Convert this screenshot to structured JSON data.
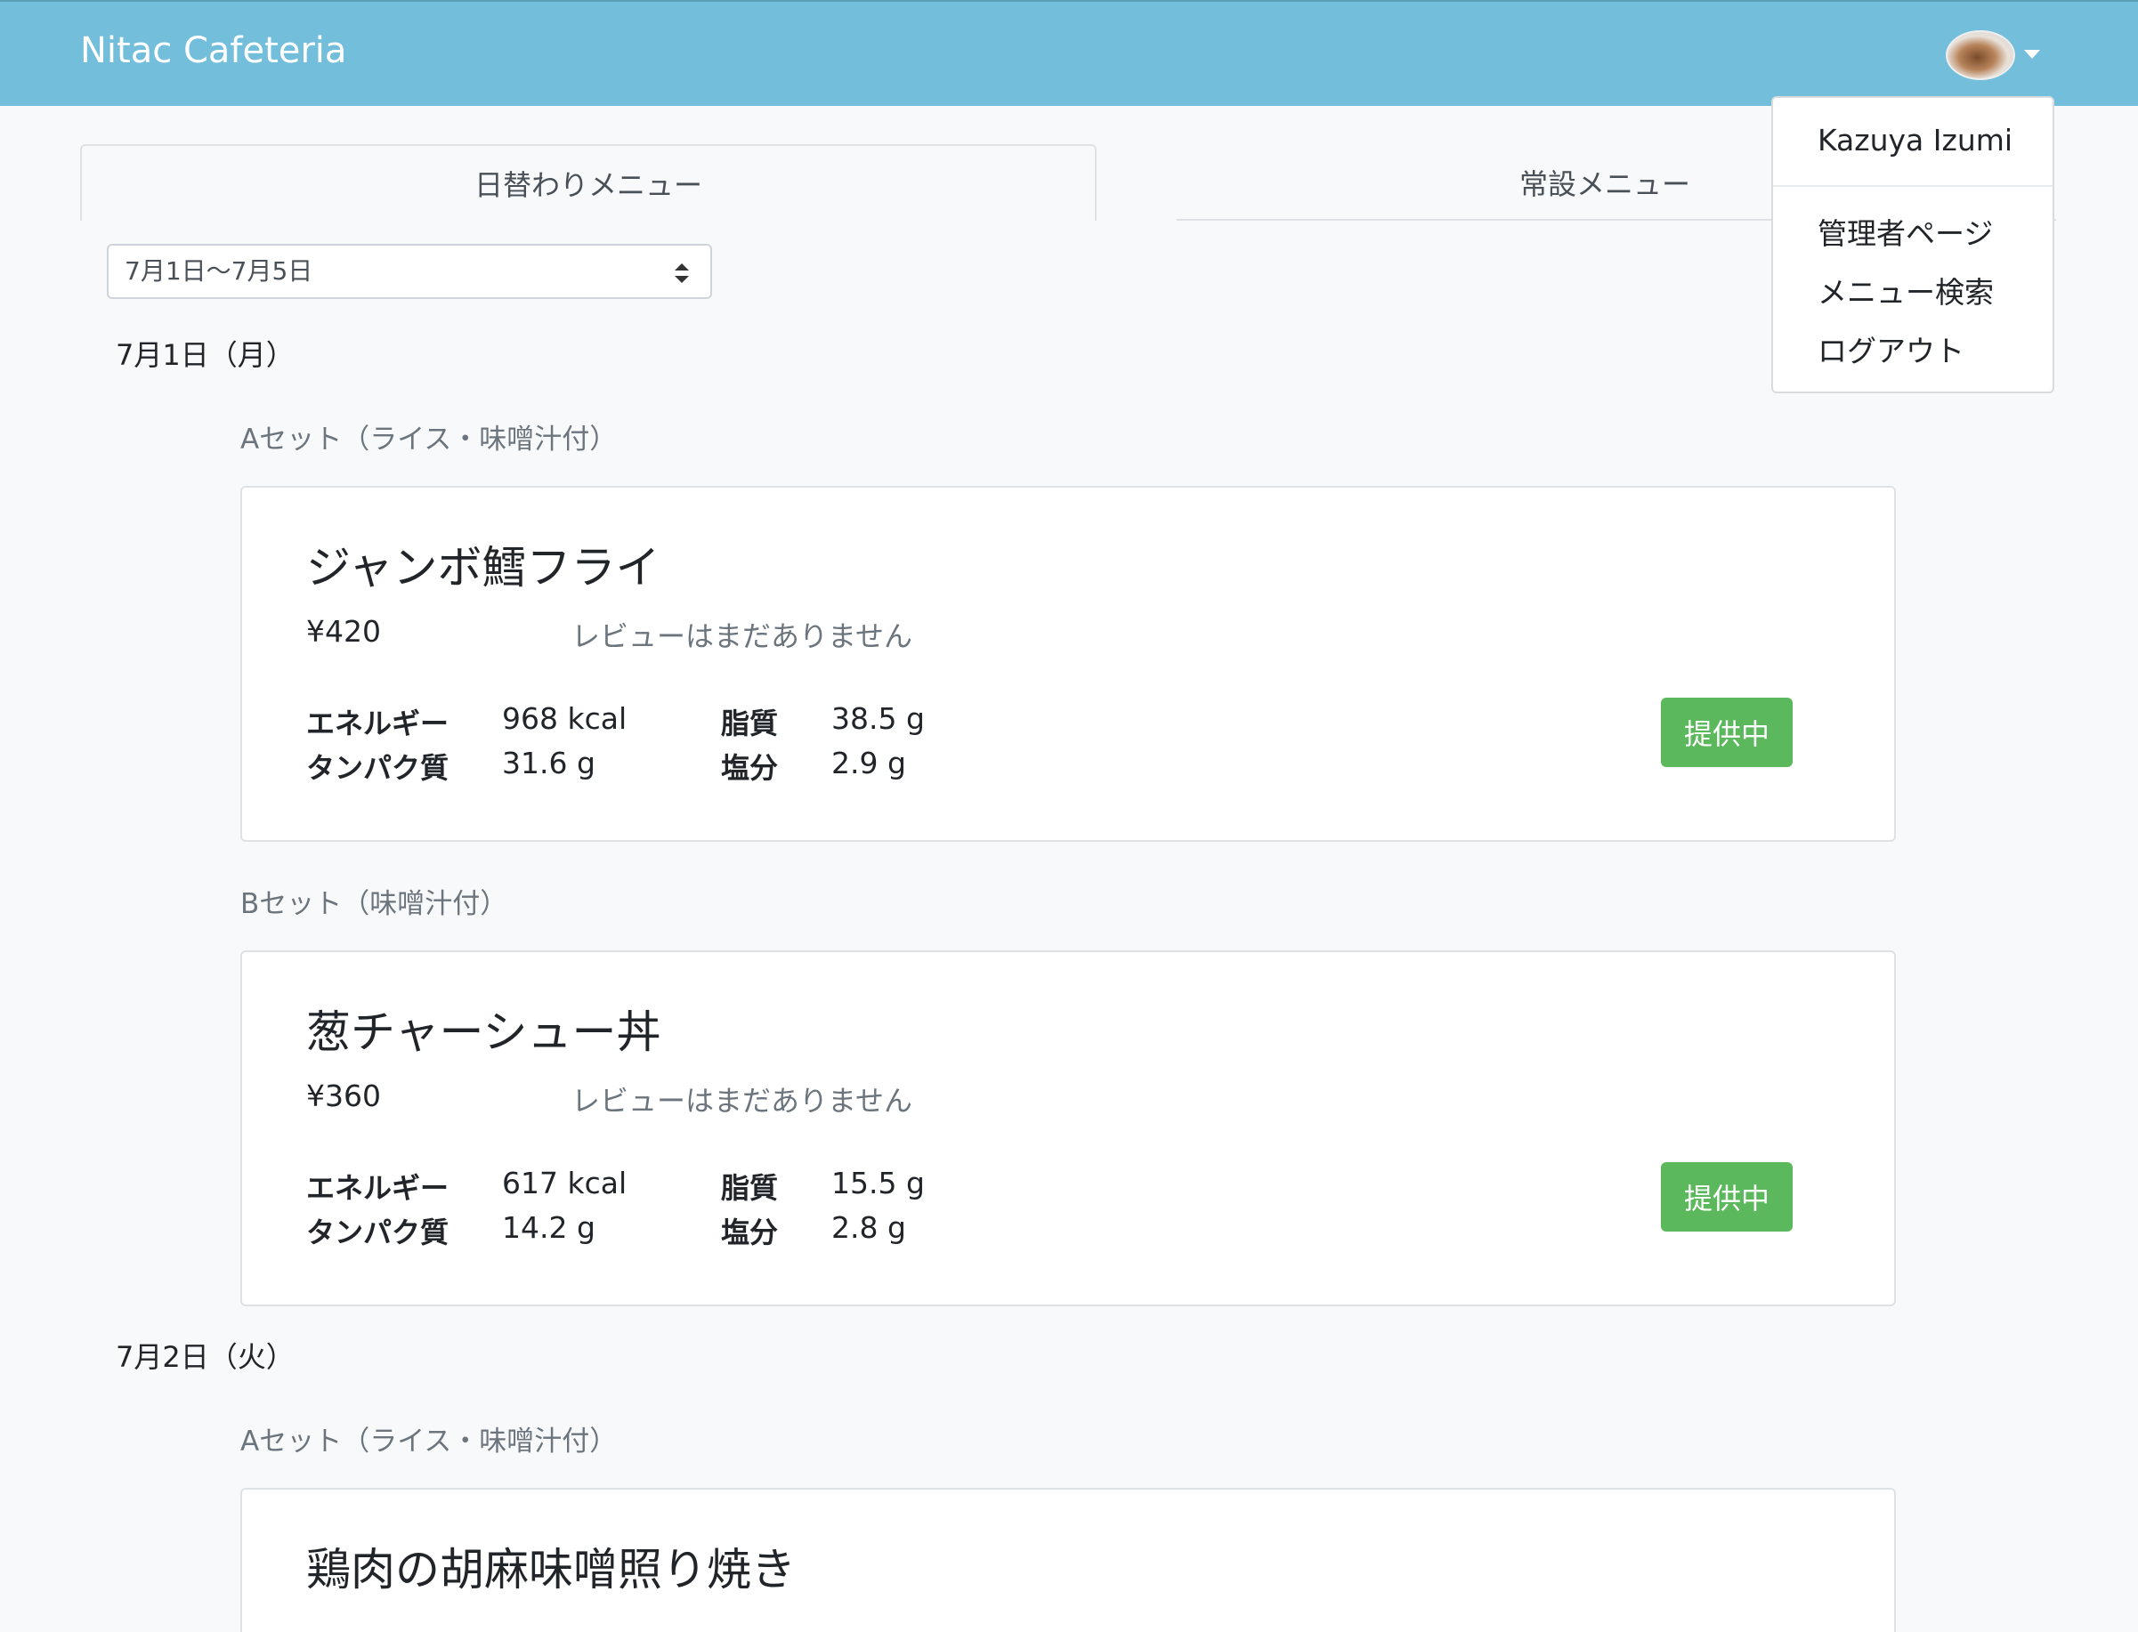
{
  "navbar": {
    "brand": "Nitac Cafeteria",
    "avatar_icon": "curry-dish-avatar",
    "menu_icon": "caret-down-icon"
  },
  "tabs": [
    {
      "label": "日替わりメニュー",
      "active": true
    },
    {
      "label": "常設メニュー",
      "active": false
    }
  ],
  "week_select": {
    "selected": "7月1日〜7月5日"
  },
  "days": [
    {
      "heading": "7月1日（月）",
      "sets": [
        {
          "label": "Aセット（ライス・味噌汁付）",
          "name": "ジャンボ鱈フライ",
          "price": "¥420",
          "review": "レビューはまだありません",
          "nutrition": {
            "energy_label": "エネルギー",
            "energy": "968 kcal",
            "protein_label": "タンパク質",
            "protein": "31.6 g",
            "fat_label": "脂質",
            "fat": "38.5 g",
            "salt_label": "塩分",
            "salt": "2.9 g"
          },
          "status": "提供中"
        },
        {
          "label": "Bセット（味噌汁付）",
          "name": "葱チャーシュー丼",
          "price": "¥360",
          "review": "レビューはまだありません",
          "nutrition": {
            "energy_label": "エネルギー",
            "energy": "617 kcal",
            "protein_label": "タンパク質",
            "protein": "14.2 g",
            "fat_label": "脂質",
            "fat": "15.5 g",
            "salt_label": "塩分",
            "salt": "2.8 g"
          },
          "status": "提供中"
        }
      ]
    },
    {
      "heading": "7月2日（火）",
      "sets": [
        {
          "label": "Aセット（ライス・味噌汁付）",
          "name": "鶏肉の胡麻味噌照り焼き"
        }
      ]
    }
  ],
  "user_menu": {
    "user_name": "Kazuya Izumi",
    "items": [
      "管理者ページ",
      "メニュー検索",
      "ログアウト"
    ]
  },
  "colors": {
    "navbar": "#72bedb",
    "badge": "#5cb85c",
    "background": "#f8f9fa"
  }
}
